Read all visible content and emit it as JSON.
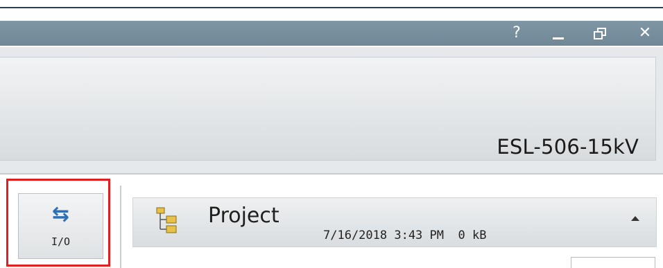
{
  "titlebar": {
    "help_glyph": "?",
    "close_glyph": "✕"
  },
  "header": {
    "device_name": "ESL-506-15kV"
  },
  "toolbar": {
    "io_button": {
      "label": "I/O",
      "icon": "swap-arrows-icon",
      "icon_glyph": "⇆"
    }
  },
  "project": {
    "title": "Project",
    "icon": "folder-tree-icon",
    "date": "7/16/2018 3:43 PM",
    "size": "0 kB"
  },
  "colors": {
    "titlebar": "#758c9a",
    "highlight": "#e02020",
    "io_icon": "#2f6fb6"
  }
}
